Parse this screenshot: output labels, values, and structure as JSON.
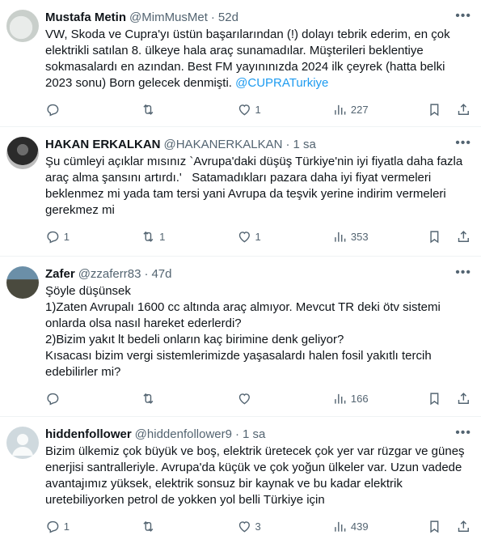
{
  "tweets": [
    {
      "name": "Mustafa Metin",
      "handle": "@MimMusMet",
      "dot": "·",
      "time": "52d",
      "body": "VW, Skoda ve Cupra'yı üstün başarılarından (!) dolayı tebrik ederim, en çok elektrikli satılan 8. ülkeye hala araç sunamadılar. Müşterileri beklentiye sokmasalardı en azından. Best FM yayınınızda 2024 ilk çeyrek (hatta belki 2023 sonu) Born gelecek denmişti. ",
      "mention": "@CUPRATurkiye",
      "replies": "",
      "retweets": "",
      "likes": "1",
      "views": "227"
    },
    {
      "name": "HAKAN ERKALKAN",
      "handle": "@HAKANERKALKAN",
      "dot": "·",
      "time": "1 sa",
      "body": "Şu cümleyi açıklar mısınız `Avrupa'daki düşüş Türkiye'nin iyi fiyatla daha fazla araç alma şansını artırdı.'   Satamadıkları pazara daha iyi fiyat vermeleri beklenmez mi yada tam tersi yani Avrupa da teşvik yerine indirim vermeleri gerekmez mi",
      "mention": "",
      "replies": "1",
      "retweets": "1",
      "likes": "1",
      "views": "353"
    },
    {
      "name": "Zafer",
      "handle": "@zzaferr83",
      "dot": "·",
      "time": "47d",
      "body": "Şöyle düşünsek\n1)Zaten Avrupalı 1600 cc altında araç almıyor. Mevcut TR deki ötv sistemi onlarda olsa nasıl hareket ederlerdi?\n2)Bizim yakıt lt bedeli onların kaç birimine denk geliyor?\nKısacası bizim vergi sistemlerimizde yaşasalardı halen fosil yakıtlı tercih edebilirler mi?",
      "mention": "",
      "replies": "",
      "retweets": "",
      "likes": "",
      "views": "166"
    },
    {
      "name": "hiddenfollower",
      "handle": "@hiddenfollower9",
      "dot": "·",
      "time": "1 sa",
      "body": "Bizim ülkemiz çok büyük ve boş, elektrik üretecek çok yer var rüzgar ve güneş enerjisi santralleriyle. Avrupa'da küçük ve çok yoğun ülkeler var. Uzun vadede avantajımız yüksek, elektrik sonsuz bir kaynak ve bu kadar elektrik uretebiliyorken petrol de yokken yol belli Türkiye için",
      "mention": "",
      "replies": "1",
      "retweets": "",
      "likes": "3",
      "views": "439"
    }
  ],
  "icons": {
    "more": "more-icon",
    "reply": "reply-icon",
    "retweet": "retweet-icon",
    "like": "like-icon",
    "views": "views-icon",
    "bookmark": "bookmark-icon",
    "share": "share-icon"
  },
  "colors": {
    "text": "#0f1419",
    "secondary": "#536471",
    "link": "#1d9bf0",
    "divider": "#eff3f4"
  }
}
